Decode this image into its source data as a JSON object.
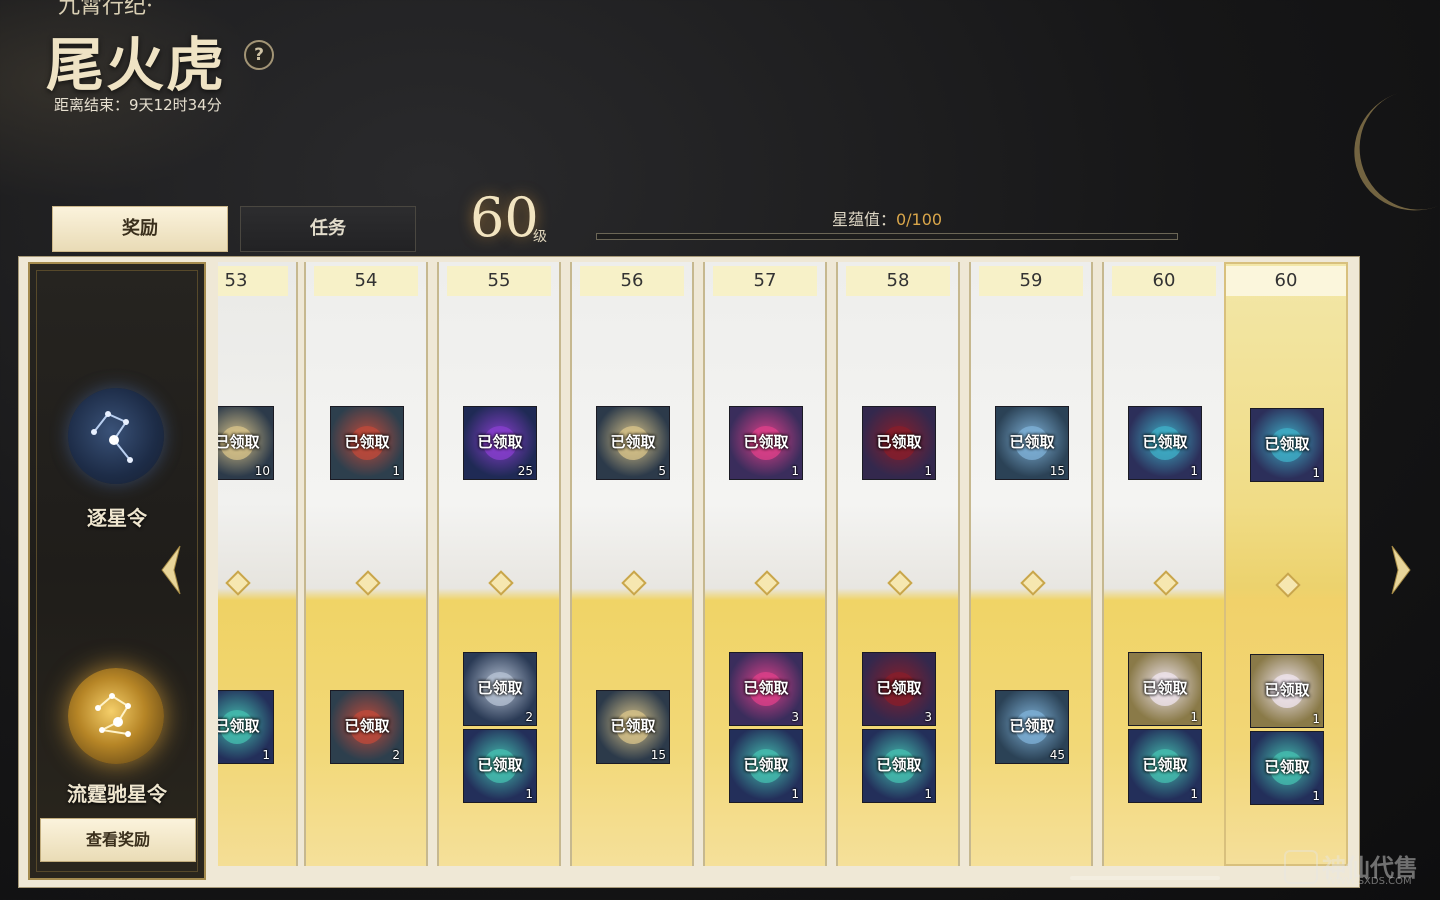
{
  "header": {
    "subtitle": "九霄行纪·",
    "title": "尾火虎",
    "help_symbol": "?",
    "countdown": "距离结束：9天12时34分"
  },
  "tabs": [
    {
      "label": "奖励",
      "active": true
    },
    {
      "label": "任务",
      "active": false
    }
  ],
  "level": {
    "value": "60",
    "unit": "级"
  },
  "progress": {
    "label": "星蕴值：",
    "value_text": "0/100",
    "fraction": 0.0
  },
  "sidebar": {
    "tier1_name": "逐星令",
    "tier2_name": "流霆驰星令",
    "view_button": "查看奖励"
  },
  "claimed_label": "已领取",
  "columns": [
    {
      "level": "53",
      "top": [
        {
          "qty": "10",
          "icon": "scroll-icon"
        }
      ],
      "bottom": [
        {
          "qty": "1",
          "icon": "crystal-icon"
        }
      ]
    },
    {
      "level": "54",
      "top": [
        {
          "qty": "1",
          "icon": "jar-icon"
        }
      ],
      "bottom": [
        {
          "qty": "2",
          "icon": "jar-icon"
        }
      ]
    },
    {
      "level": "55",
      "top": [
        {
          "qty": "25",
          "icon": "orb-icon"
        }
      ],
      "bottom": [
        {
          "qty": "2",
          "icon": "pouch-icon"
        },
        {
          "qty": "1",
          "icon": "crystal-icon"
        }
      ]
    },
    {
      "level": "56",
      "top": [
        {
          "qty": "5",
          "icon": "scroll-icon"
        }
      ],
      "bottom": [
        {
          "qty": "15",
          "icon": "scroll-icon"
        }
      ]
    },
    {
      "level": "57",
      "top": [
        {
          "qty": "1",
          "icon": "pink-orb-icon"
        }
      ],
      "bottom": [
        {
          "qty": "3",
          "icon": "pink-orb-icon"
        },
        {
          "qty": "1",
          "icon": "crystal-icon"
        }
      ]
    },
    {
      "level": "58",
      "top": [
        {
          "qty": "1",
          "icon": "red-bag-icon"
        }
      ],
      "bottom": [
        {
          "qty": "3",
          "icon": "red-bag-icon"
        },
        {
          "qty": "1",
          "icon": "crystal-icon"
        }
      ]
    },
    {
      "level": "59",
      "top": [
        {
          "qty": "15",
          "icon": "gem-icon"
        }
      ],
      "bottom": [
        {
          "qty": "45",
          "icon": "gem-icon"
        }
      ]
    },
    {
      "level": "60",
      "top": [
        {
          "qty": "1",
          "icon": "teal-orb-icon"
        }
      ],
      "bottom": [
        {
          "qty": "1",
          "icon": "bunny-icon"
        },
        {
          "qty": "1",
          "icon": "crystal-icon"
        }
      ]
    },
    {
      "level": "60",
      "top": [
        {
          "qty": "1",
          "icon": "teal-orb-icon"
        }
      ],
      "bottom": [
        {
          "qty": "1",
          "icon": "bunny-icon"
        },
        {
          "qty": "1",
          "icon": "crystal-icon"
        }
      ]
    }
  ],
  "colors": {
    "accent_gold": "#d9a64a",
    "panel_white": "#f1f1ef",
    "panel_gold": "#f2d877"
  },
  "watermark": {
    "text": "神仙代售",
    "url": "WWW.SXDS.COM"
  }
}
